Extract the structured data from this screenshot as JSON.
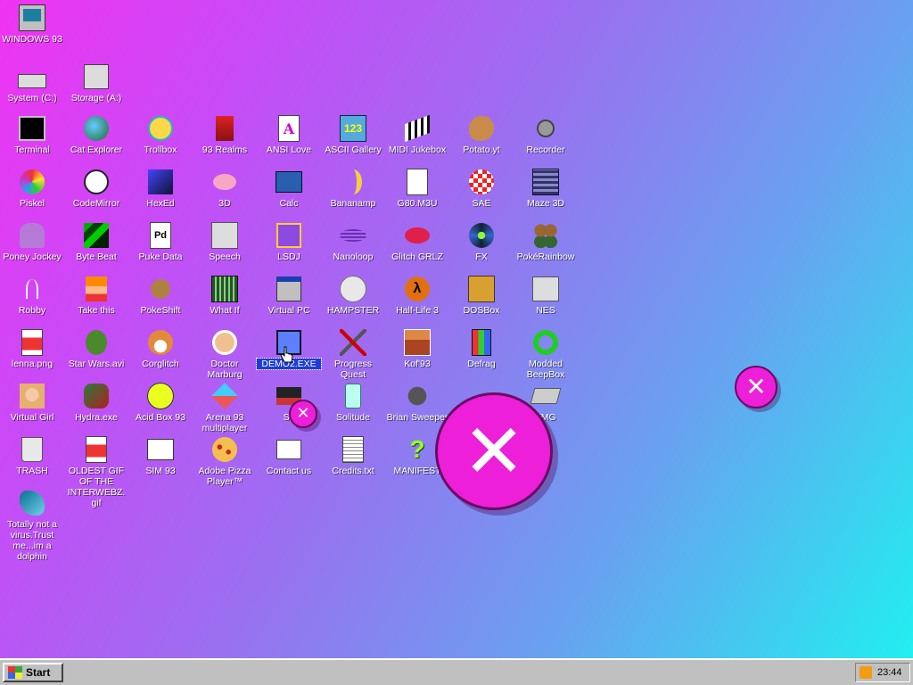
{
  "desktop": {
    "icons": [
      {
        "label": "WINDOWS 93",
        "glyph": "computer-icon"
      },
      {
        "label": "System (C:)",
        "glyph": "hard-drive-icon"
      },
      {
        "label": "Storage (A:)",
        "glyph": "floppy-drive-icon"
      },
      {
        "label": "Terminal",
        "glyph": "terminal-icon"
      },
      {
        "label": "Cat Explorer",
        "glyph": "cat-globe-icon"
      },
      {
        "label": "Trollbox",
        "glyph": "chat-bubble-icon"
      },
      {
        "label": "93 Realms",
        "glyph": "knight-icon"
      },
      {
        "label": "ANSI Love",
        "glyph": "letter-a-icon"
      },
      {
        "label": "ASCII Gallery",
        "glyph": "numbers-icon"
      },
      {
        "label": "MIDI Jukebox",
        "glyph": "piano-icon"
      },
      {
        "label": "Potato.yt",
        "glyph": "potato-icon"
      },
      {
        "label": "Recorder",
        "glyph": "microphone-icon"
      },
      {
        "label": "Piskel",
        "glyph": "palette-icon"
      },
      {
        "label": "CodeMirror",
        "glyph": "code-icon"
      },
      {
        "label": "HexEd",
        "glyph": "cube-icon"
      },
      {
        "label": "3D",
        "glyph": "teapot-icon"
      },
      {
        "label": "Calc",
        "glyph": "calculator-icon"
      },
      {
        "label": "Bananamp",
        "glyph": "banana-icon"
      },
      {
        "label": "G80.M3U",
        "glyph": "audio-file-icon"
      },
      {
        "label": "SAE",
        "glyph": "ball-icon"
      },
      {
        "label": "Maze 3D",
        "glyph": "maze-icon"
      },
      {
        "label": "Poney Jockey",
        "glyph": "pony-icon"
      },
      {
        "label": "Byte Beat",
        "glyph": "bytebeat-icon"
      },
      {
        "label": "Puke Data",
        "glyph": "pd-icon"
      },
      {
        "label": "Speech",
        "glyph": "face-icon"
      },
      {
        "label": "LSDJ",
        "glyph": "gameboy-icon"
      },
      {
        "label": "Nanoloop",
        "glyph": "waves-icon"
      },
      {
        "label": "Glitch GRLZ",
        "glyph": "lips-icon"
      },
      {
        "label": "FX",
        "glyph": "atom-icon"
      },
      {
        "label": "PokéRainbow",
        "glyph": "sprites-icon"
      },
      {
        "label": "Robby",
        "glyph": "stick-figure-icon"
      },
      {
        "label": "Take this",
        "glyph": "pixel-character-icon"
      },
      {
        "label": "PokeShift",
        "glyph": "creature-icon"
      },
      {
        "label": "What If",
        "glyph": "film-icon"
      },
      {
        "label": "Virtual PC",
        "glyph": "window-icon"
      },
      {
        "label": "HAMPSTER",
        "glyph": "hamster-icon"
      },
      {
        "label": "Half-Life 3",
        "glyph": "lambda-icon"
      },
      {
        "label": "DOSBox",
        "glyph": "dosbox-icon"
      },
      {
        "label": "NES",
        "glyph": "nes-icon"
      },
      {
        "label": "lenna.png",
        "glyph": "image-file-icon"
      },
      {
        "label": "Star Wars.avi",
        "glyph": "yoda-icon"
      },
      {
        "label": "Corglitch",
        "glyph": "corgi-icon"
      },
      {
        "label": "Doctor Marburg",
        "glyph": "doctor-icon"
      },
      {
        "label": "DEMO2.EXE",
        "glyph": "demo-icon"
      },
      {
        "label": "Progress Quest",
        "glyph": "swords-icon"
      },
      {
        "label": "Kof'93",
        "glyph": "fighter-icon"
      },
      {
        "label": "Defrag",
        "glyph": "defrag-icon"
      },
      {
        "label": "Modded BeepBox",
        "glyph": "ring-icon"
      },
      {
        "label": "Virtual Girl",
        "glyph": "portrait-icon"
      },
      {
        "label": "Hydra.exe",
        "glyph": "dragon-icon"
      },
      {
        "label": "Acid Box 93",
        "glyph": "smiley-icon"
      },
      {
        "label": "Arena 93 multiplayer",
        "glyph": "box-icon"
      },
      {
        "label": "Sh",
        "glyph": "console-icon"
      },
      {
        "label": "Solitude",
        "glyph": "bottle-icon"
      },
      {
        "label": "Brian Sweeper",
        "glyph": "mine-icon"
      },
      {
        "label": "TMG",
        "glyph": "device-icon"
      },
      {
        "label": "TRASH",
        "glyph": "trash-icon"
      },
      {
        "label": "OLDEST GIF OF THE INTERWEBZ.gif",
        "glyph": "gif-file-icon"
      },
      {
        "label": "SIM 93",
        "glyph": "book-icon"
      },
      {
        "label": "Adobe Pizza Player™",
        "glyph": "pizza-icon"
      },
      {
        "label": "Contact us",
        "glyph": "letter-icon"
      },
      {
        "label": "Credits.txt",
        "glyph": "text-file-icon"
      },
      {
        "label": "MANIFEST",
        "glyph": "question-icon"
      },
      {
        "label": "Totally not a virus.Trust me...im a dolphin",
        "glyph": "dolphin-icon"
      }
    ]
  },
  "popups": {
    "close_glyph": "✕"
  },
  "taskbar": {
    "start_label": "Start",
    "clock": "23:44",
    "tray_icon": "rss-feed-icon"
  }
}
